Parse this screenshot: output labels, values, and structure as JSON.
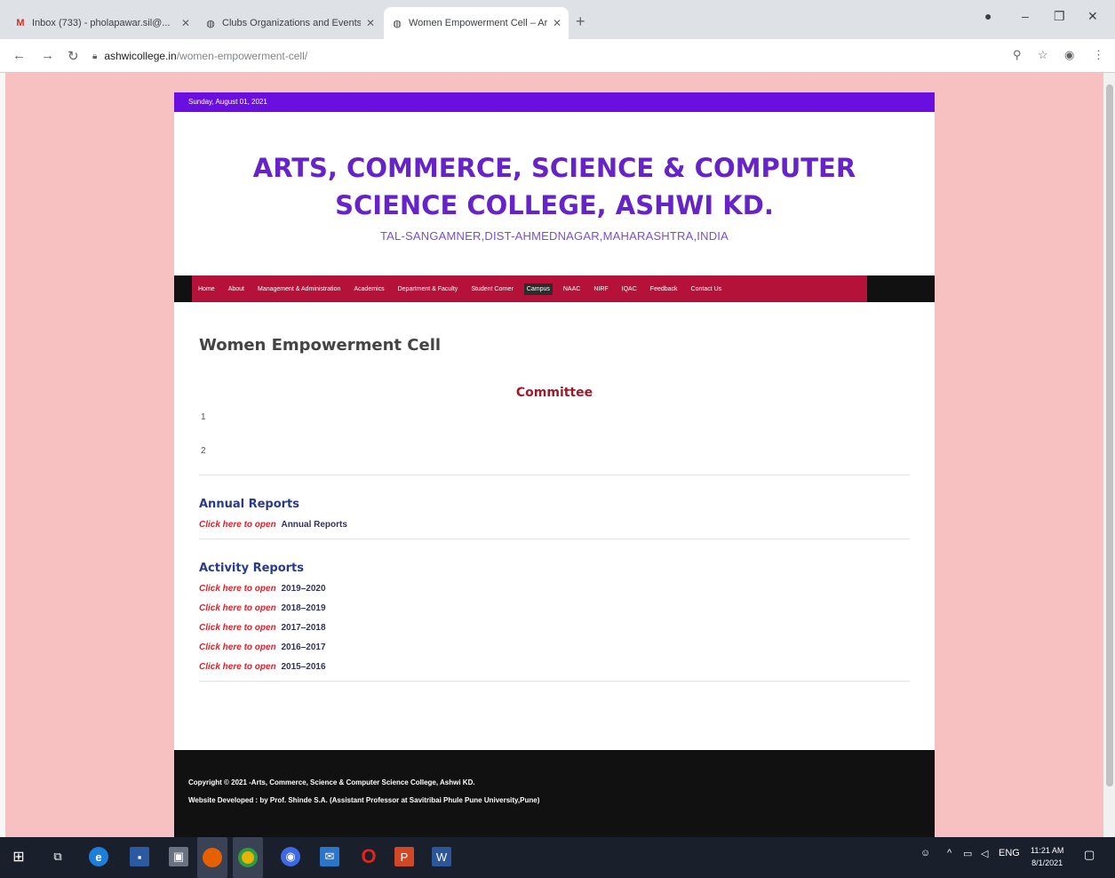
{
  "browser": {
    "tabs": [
      {
        "title": "Inbox (733) - pholapawar.sil@...",
        "icon": "gmail-icon"
      },
      {
        "title": "Clubs Organizations and Events",
        "icon": "globe-icon"
      },
      {
        "title": "Women Empowerment Cell – Ar...",
        "icon": "globe-icon"
      }
    ],
    "url_host": "ashwicollege.in",
    "url_path": "/women-empowerment-cell/"
  },
  "site": {
    "date_strip": "Sunday, August 01, 2021",
    "title": "ARTS, COMMERCE, SCIENCE & COMPUTER SCIENCE COLLEGE, ASHWI KD.",
    "subtitle": "TAL-SANGAMNER,DIST-AHMEDNAGAR,MAHARASHTRA,INDIA",
    "menu": [
      "Home",
      "About",
      "Management & Administration",
      "Academics",
      "Department & Faculty",
      "Student Corner",
      "Campus",
      "NAAC",
      "NIRF",
      "IQAC",
      "Feedback",
      "Contact Us"
    ]
  },
  "content": {
    "heading": "Women Empowerment Cell",
    "committee_title": "Committee",
    "committee_numbers": [
      "1",
      "2"
    ],
    "annual": {
      "title": "Annual Reports",
      "link_text": "Click here to open",
      "label": "Annual Reports"
    },
    "activity": {
      "title": "Activity Reports",
      "link_text": "Click here to open",
      "years": [
        "2019–2020",
        "2018–2019",
        "2017–2018",
        "2016–2017",
        "2015–2016"
      ]
    }
  },
  "footer": {
    "copyright": "Copyright © 2021 -Arts, Commerce, Science & Computer Science College, Ashwi KD.",
    "developer": "Website Developed : by Prof. Shinde S.A. (Assistant Professor at Savitribai Phule Pune University,Pune)"
  },
  "taskbar": {
    "time": "11:21 AM",
    "date": "8/1/2021",
    "lang": "ENG"
  },
  "colors": {
    "background": "#f8c1c1",
    "title": "#6623c8",
    "menu": "#b5123a",
    "strip": "#6b0fe0",
    "link": "#e0202a"
  }
}
